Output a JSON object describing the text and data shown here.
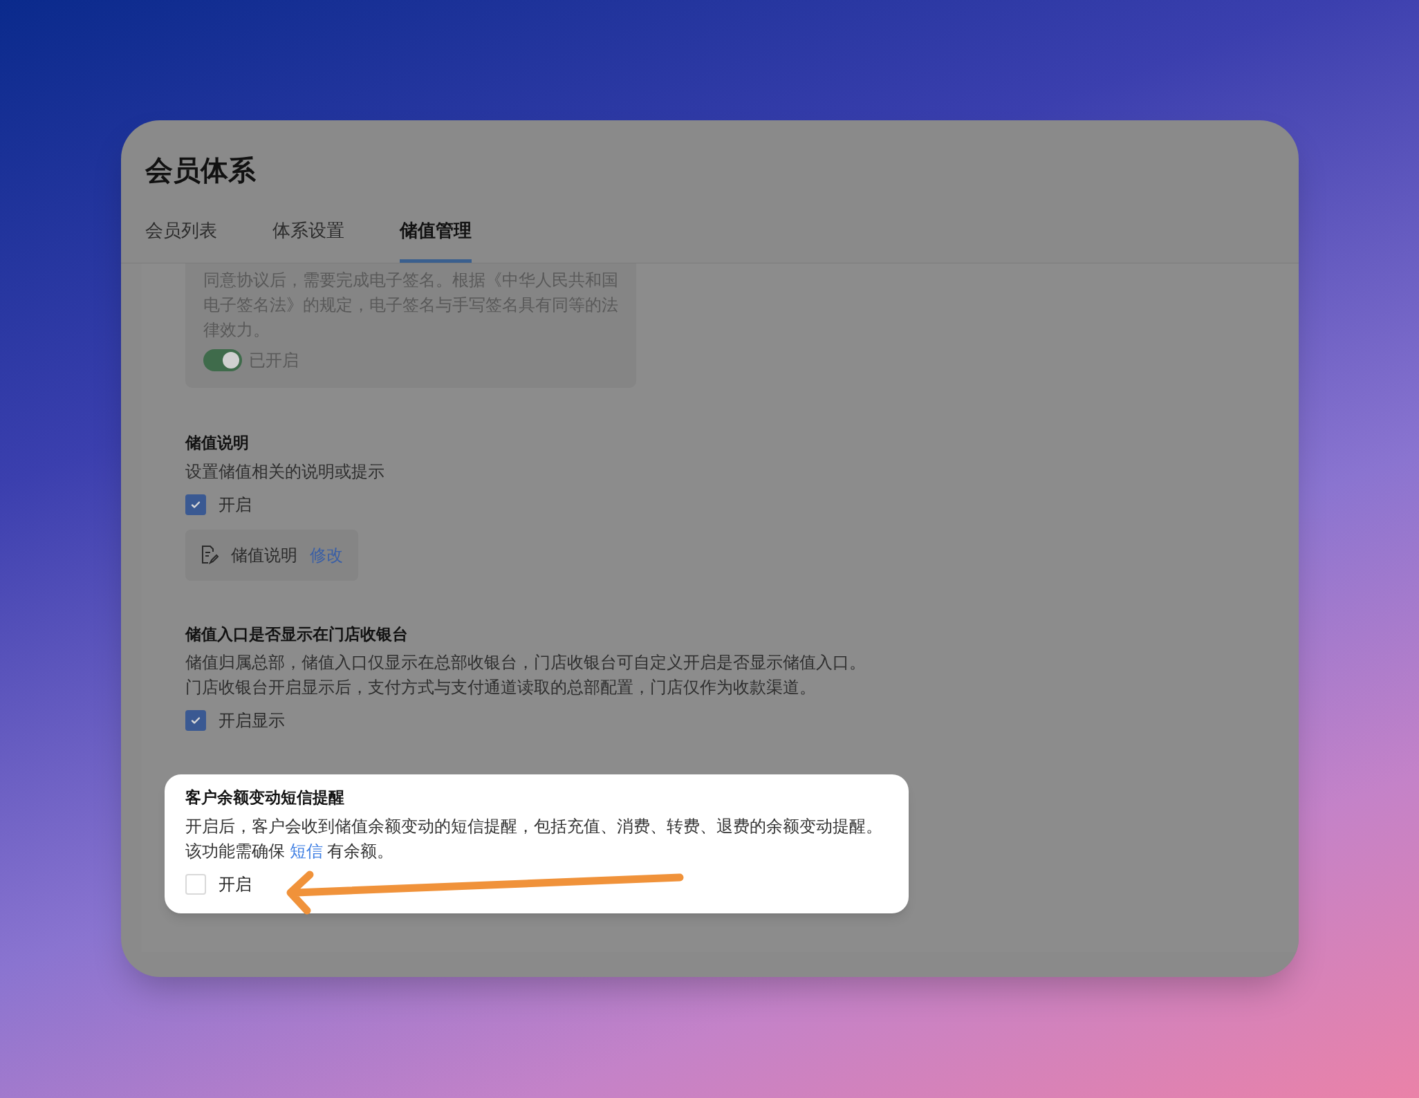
{
  "header": {
    "title": "会员体系"
  },
  "tabs": [
    {
      "label": "会员列表",
      "selected": false
    },
    {
      "label": "体系设置",
      "selected": false
    },
    {
      "label": "储值管理",
      "selected": true
    }
  ],
  "agreement": {
    "lines": [
      "同意协议后，需要完成电子签名。根据《中华人民共和国",
      "电子签名法》的规定，电子签名与手写签名具有同等的法",
      "律效力。"
    ],
    "toggle": {
      "on": true,
      "label": "已开启"
    }
  },
  "sections": [
    {
      "kind": "note",
      "highlighted": false,
      "title": "储值说明",
      "lines": [
        "设置储值相关的说明或提示"
      ],
      "checkbox": {
        "label": "开启",
        "checked": true
      },
      "note": {
        "label": "储值说明",
        "link": "修改"
      }
    },
    {
      "kind": "plain",
      "highlighted": false,
      "title": "储值入口是否显示在门店收银台",
      "lines": [
        "储值归属总部，储值入口仅显示在总部收银台，门店收银台可自定义开启是否显示储值入口。",
        "门店收银台开启显示后，支付方式与支付通道读取的总部配置，门店仅作为收款渠道。"
      ],
      "checkbox": {
        "label": "开启显示",
        "checked": true
      }
    },
    {
      "kind": "link",
      "highlighted": true,
      "title": "客户余额变动短信提醒",
      "lines": [
        "开启后，客户会收到储值余额变动的短信提醒，包括充值、消费、转费、退费的余额变动提醒。"
      ],
      "link_line": {
        "before": "该功能需确保",
        "link": "短信",
        "after": "有余额。"
      },
      "checkbox": {
        "label": "开启",
        "checked": false
      },
      "annotation": {
        "kind": "arrow"
      }
    }
  ]
}
